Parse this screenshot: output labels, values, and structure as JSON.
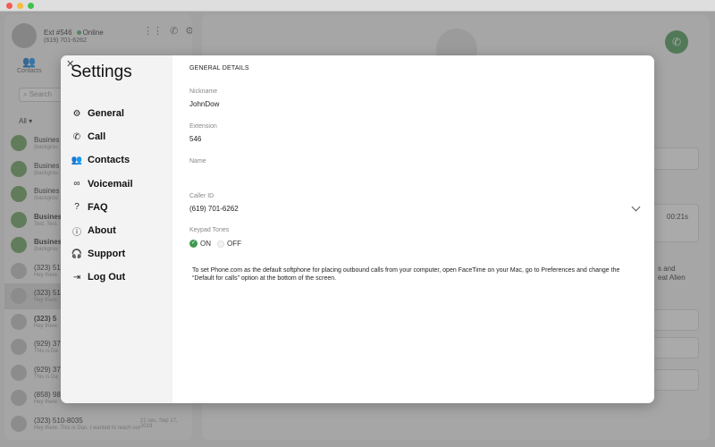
{
  "window": {
    "title": ""
  },
  "account": {
    "extension_label": "Ext #546",
    "status": "Online",
    "phone": "(619) 701-6262"
  },
  "left_panel": {
    "contacts_tab": "Contacts",
    "search_placeholder": "Search",
    "filter": "All",
    "conversations": [
      {
        "title": "Busines",
        "subtitle": "(backgrou",
        "brand": true,
        "bold": false
      },
      {
        "title": "Busines",
        "subtitle": "(backgrou",
        "brand": true,
        "bold": false
      },
      {
        "title": "Busines",
        "subtitle": "(backgrou",
        "brand": true,
        "bold": false
      },
      {
        "title": "Busines",
        "subtitle": "Test. Test.",
        "brand": true,
        "bold": true
      },
      {
        "title": "Busines",
        "subtitle": "(backgrou",
        "brand": true,
        "bold": true
      },
      {
        "title": "(323) 51",
        "subtitle": "Hey there",
        "brand": false,
        "bold": false
      },
      {
        "title": "(323) 51",
        "subtitle": "Hey there",
        "brand": false,
        "bold": false,
        "selected": true
      },
      {
        "title": "(323) 5",
        "subtitle": "Hey there",
        "brand": false,
        "bold": true
      },
      {
        "title": "(929) 37",
        "subtitle": "This is Da",
        "brand": false,
        "bold": false
      },
      {
        "title": "(929) 37",
        "subtitle": "This is Da",
        "brand": false,
        "bold": false
      },
      {
        "title": "(858) 98",
        "subtitle": "Hey there",
        "brand": false,
        "bold": false
      },
      {
        "title": "(323) 510-8035",
        "subtitle": "Hey there. This is Dan. I wanted to reach out to y...",
        "time": "21 sec, Sep 17, 2019",
        "brand": false,
        "bold": false
      }
    ]
  },
  "right_panel": {
    "duration": "00:21s",
    "snippet_line1": "s and",
    "snippet_line2": "eat Alien"
  },
  "settings": {
    "title": "Settings",
    "menu": [
      {
        "label": "General",
        "icon": "⚙"
      },
      {
        "label": "Call",
        "icon": "✆"
      },
      {
        "label": "Contacts",
        "icon": "👥"
      },
      {
        "label": "Voicemail",
        "icon": "∞"
      },
      {
        "label": "FAQ",
        "icon": "?"
      },
      {
        "label": "About",
        "icon": "ⓘ"
      },
      {
        "label": "Support",
        "icon": "🎧"
      },
      {
        "label": "Log Out",
        "icon": "⇥"
      }
    ],
    "section_title": "GENERAL DETAILS",
    "nickname_label": "Nickname",
    "nickname_value": "JohnDow",
    "extension_label": "Extension",
    "extension_value": "546",
    "name_label": "Name",
    "name_value": "",
    "caller_id_label": "Caller ID",
    "caller_id_value": "(619) 701-6262",
    "keypad_tones_label": "Keypad Tones",
    "tone_on": "ON",
    "tone_off": "OFF",
    "note": "To set Phone.com as the default softphone for placing outbound calls from your computer, open FaceTime on your Mac, go to Preferences and change the “Default for calls” option at the bottom of the screen."
  }
}
